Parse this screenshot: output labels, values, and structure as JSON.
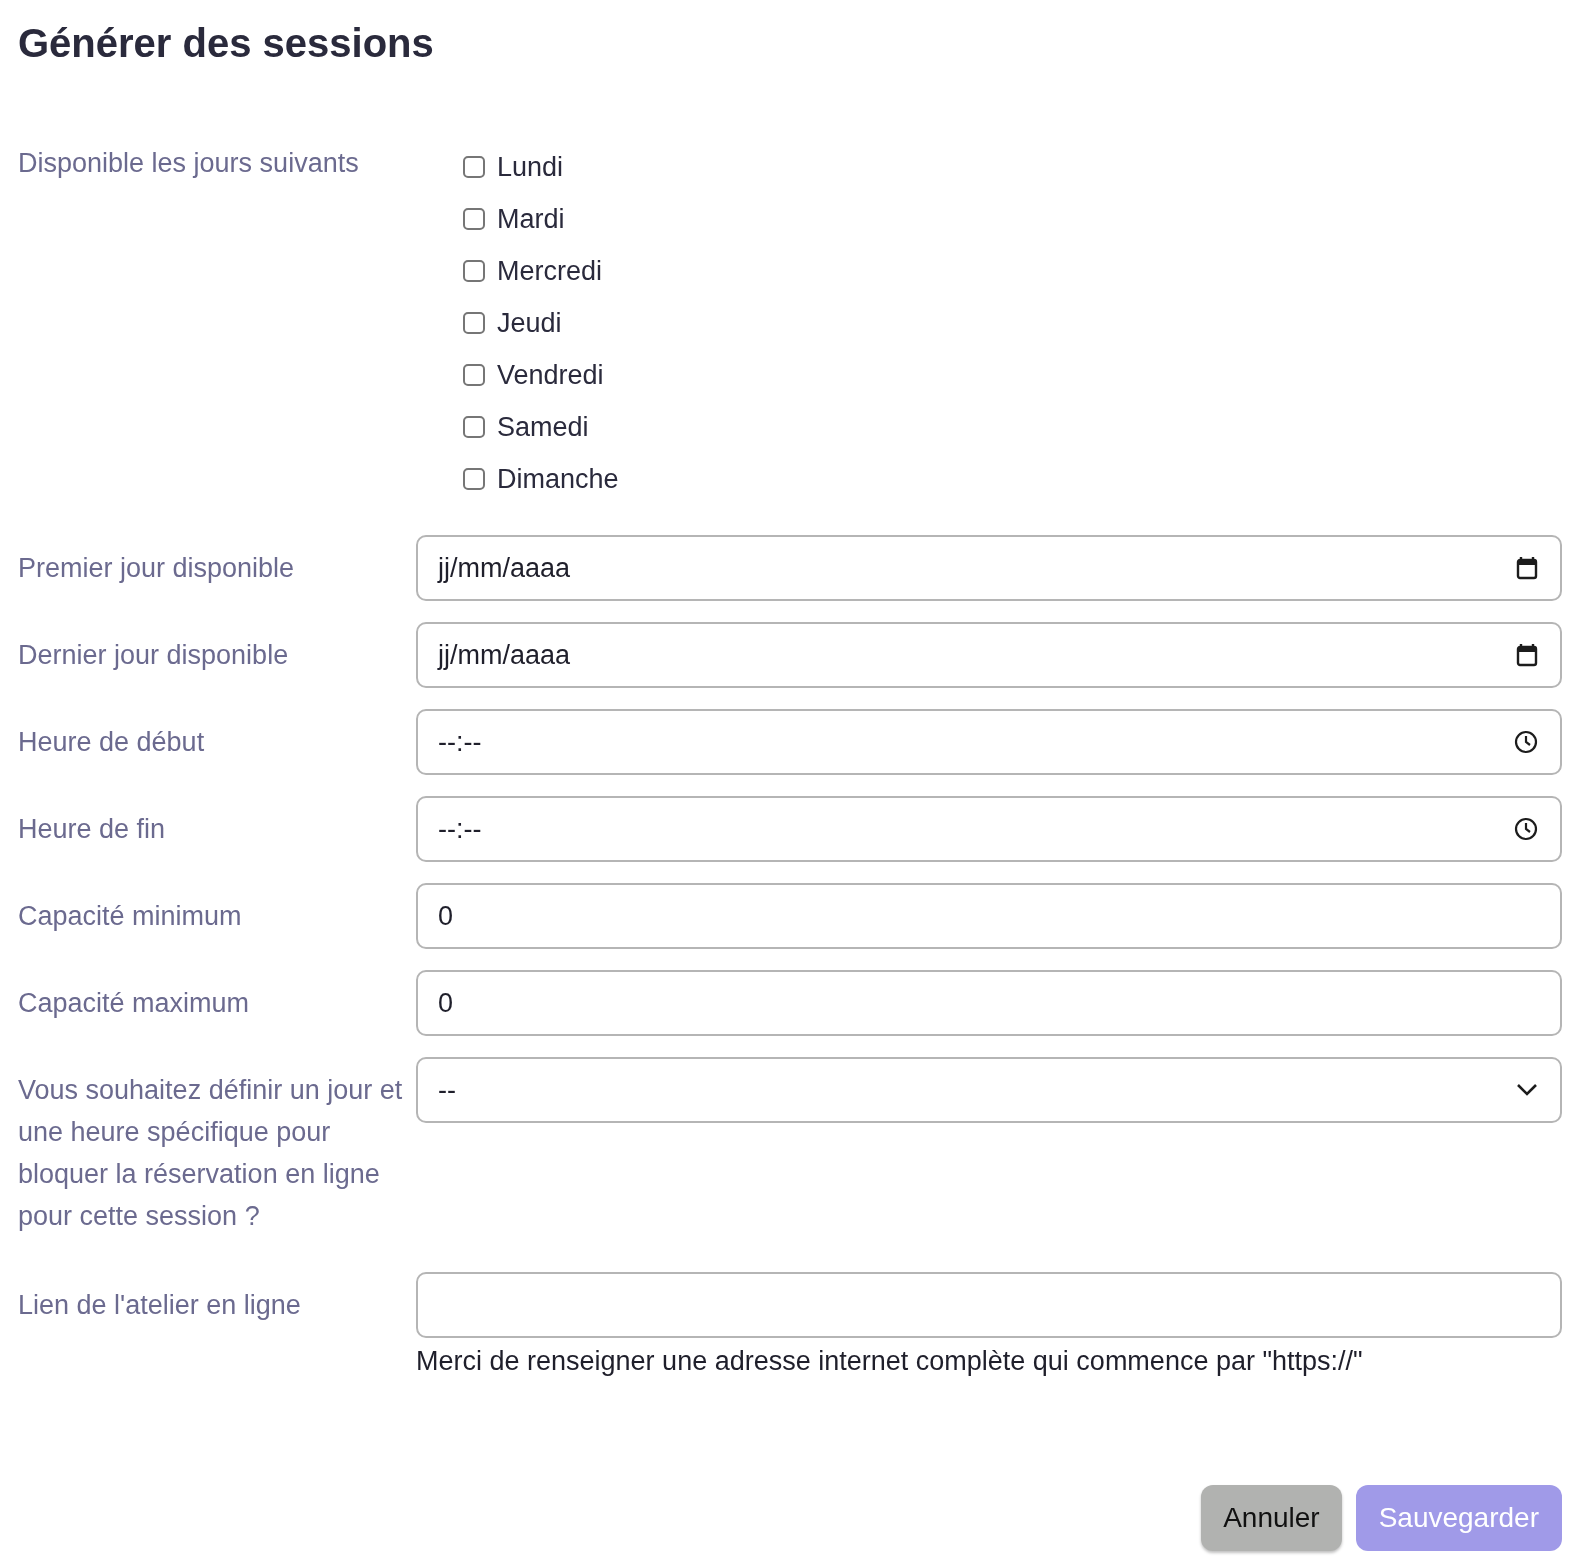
{
  "title": "Générer des sessions",
  "days": {
    "label": "Disponible les jours suivants",
    "options": [
      {
        "label": "Lundi",
        "checked": false
      },
      {
        "label": "Mardi",
        "checked": false
      },
      {
        "label": "Mercredi",
        "checked": false
      },
      {
        "label": "Jeudi",
        "checked": false
      },
      {
        "label": "Vendredi",
        "checked": false
      },
      {
        "label": "Samedi",
        "checked": false
      },
      {
        "label": "Dimanche",
        "checked": false
      }
    ]
  },
  "fields": [
    {
      "label": "Premier jour disponible",
      "kind": "date",
      "placeholder": "jj/mm/aaaa"
    },
    {
      "label": "Dernier jour disponible",
      "kind": "date",
      "placeholder": "jj/mm/aaaa"
    },
    {
      "label": "Heure de début",
      "kind": "time",
      "placeholder": "--:--"
    },
    {
      "label": "Heure de fin",
      "kind": "time",
      "placeholder": "--:--"
    },
    {
      "label": "Capacité minimum",
      "kind": "number",
      "value": "0"
    },
    {
      "label": "Capacité maximum",
      "kind": "number",
      "value": "0"
    },
    {
      "label": "Vous souhaitez définir un jour et une heure spécifique pour bloquer la réservation en ligne pour cette session ?",
      "kind": "select",
      "value": "--"
    },
    {
      "label": "Lien de l'atelier en ligne",
      "kind": "text",
      "help": "Merci de renseigner une adresse internet complète qui commence par \"https://\""
    }
  ],
  "buttons": [
    {
      "label": "Annuler",
      "kind": "secondary"
    },
    {
      "label": "Sauvegarder",
      "kind": "primary"
    }
  ]
}
